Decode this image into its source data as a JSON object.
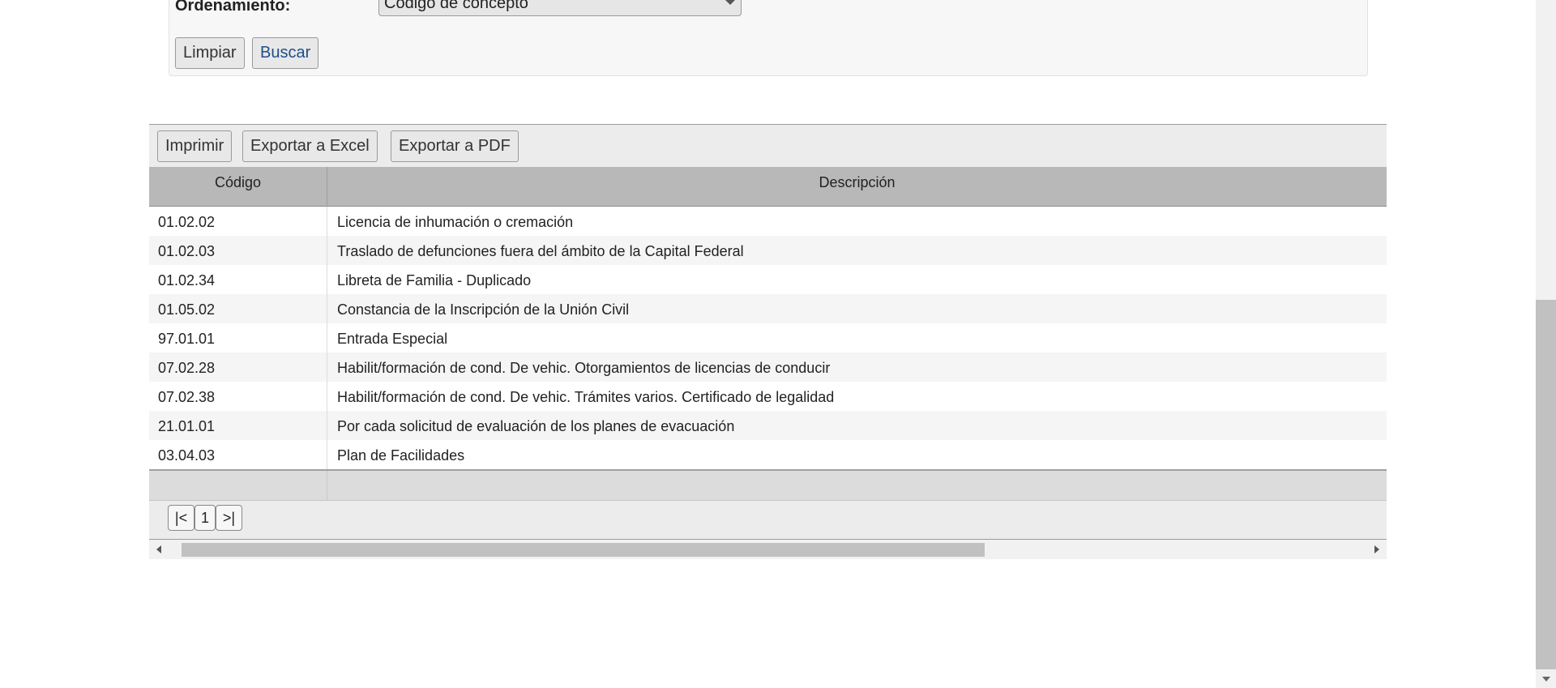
{
  "filters": {
    "order_label": "Ordenamiento:",
    "order_value": "Código de concepto",
    "clear_button": "Limpiar",
    "search_button": "Buscar"
  },
  "toolbar": {
    "print_button": "Imprimir",
    "excel_button": "Exportar a Excel",
    "pdf_button": "Exportar a PDF"
  },
  "table": {
    "columns": [
      "Código",
      "Descripción"
    ],
    "rows": [
      {
        "code": "01.02.02",
        "desc": "Licencia de inhumación o cremación"
      },
      {
        "code": "01.02.03",
        "desc": "Traslado de defunciones fuera del ámbito de la Capital Federal"
      },
      {
        "code": "01.02.34",
        "desc": "Libreta de Familia - Duplicado"
      },
      {
        "code": "01.05.02",
        "desc": "Constancia de la Inscripción de la Unión Civil"
      },
      {
        "code": "97.01.01",
        "desc": "Entrada Especial"
      },
      {
        "code": "07.02.28",
        "desc": "Habilit/formación de cond. De vehic. Otorgamientos de licencias de conducir"
      },
      {
        "code": "07.02.38",
        "desc": "Habilit/formación de cond. De vehic. Trámites varios. Certificado de legalidad"
      },
      {
        "code": "21.01.01",
        "desc": "Por cada solicitud de evaluación de los planes de evacuación"
      },
      {
        "code": "03.04.03",
        "desc": "Plan de Facilidades"
      }
    ]
  },
  "pager": {
    "first": "|<",
    "page": "1",
    "last": ">|"
  }
}
